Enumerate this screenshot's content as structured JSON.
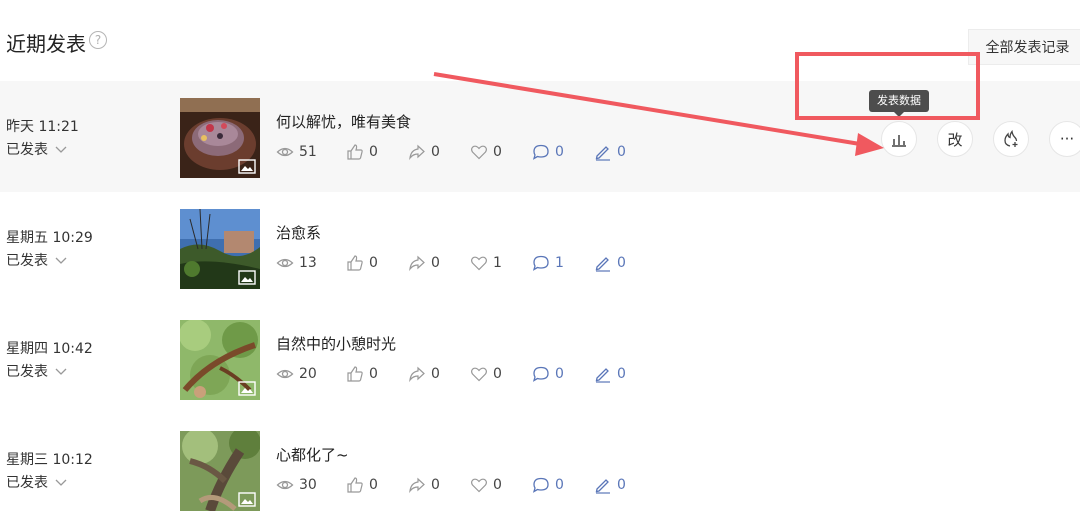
{
  "header": {
    "title": "近期发表",
    "help_icon": "?",
    "all_records_label": "全部发表记录"
  },
  "tooltip": "发表数据",
  "status_label": "已发表",
  "posts": [
    {
      "time": "昨天 11:21",
      "title": "何以解忧，唯有美食",
      "views": "51",
      "likes": "0",
      "shares": "0",
      "favorites": "0",
      "comments": "0",
      "edits": "0"
    },
    {
      "time": "星期五 10:29",
      "title": "治愈系",
      "views": "13",
      "likes": "0",
      "shares": "0",
      "favorites": "1",
      "comments": "1",
      "edits": "0"
    },
    {
      "time": "星期四 10:42",
      "title": "自然中的小憩时光",
      "views": "20",
      "likes": "0",
      "shares": "0",
      "favorites": "0",
      "comments": "0",
      "edits": "0"
    },
    {
      "time": "星期三 10:12",
      "title": "心都化了~",
      "views": "30",
      "likes": "0",
      "shares": "0",
      "favorites": "0",
      "comments": "0",
      "edits": "0"
    }
  ],
  "actions": {
    "stats_icon": "bar-chart-icon",
    "edit_label": "改",
    "promote_icon": "flame-plus-icon",
    "more_label": "···"
  },
  "annotation_color": "#f0595f"
}
